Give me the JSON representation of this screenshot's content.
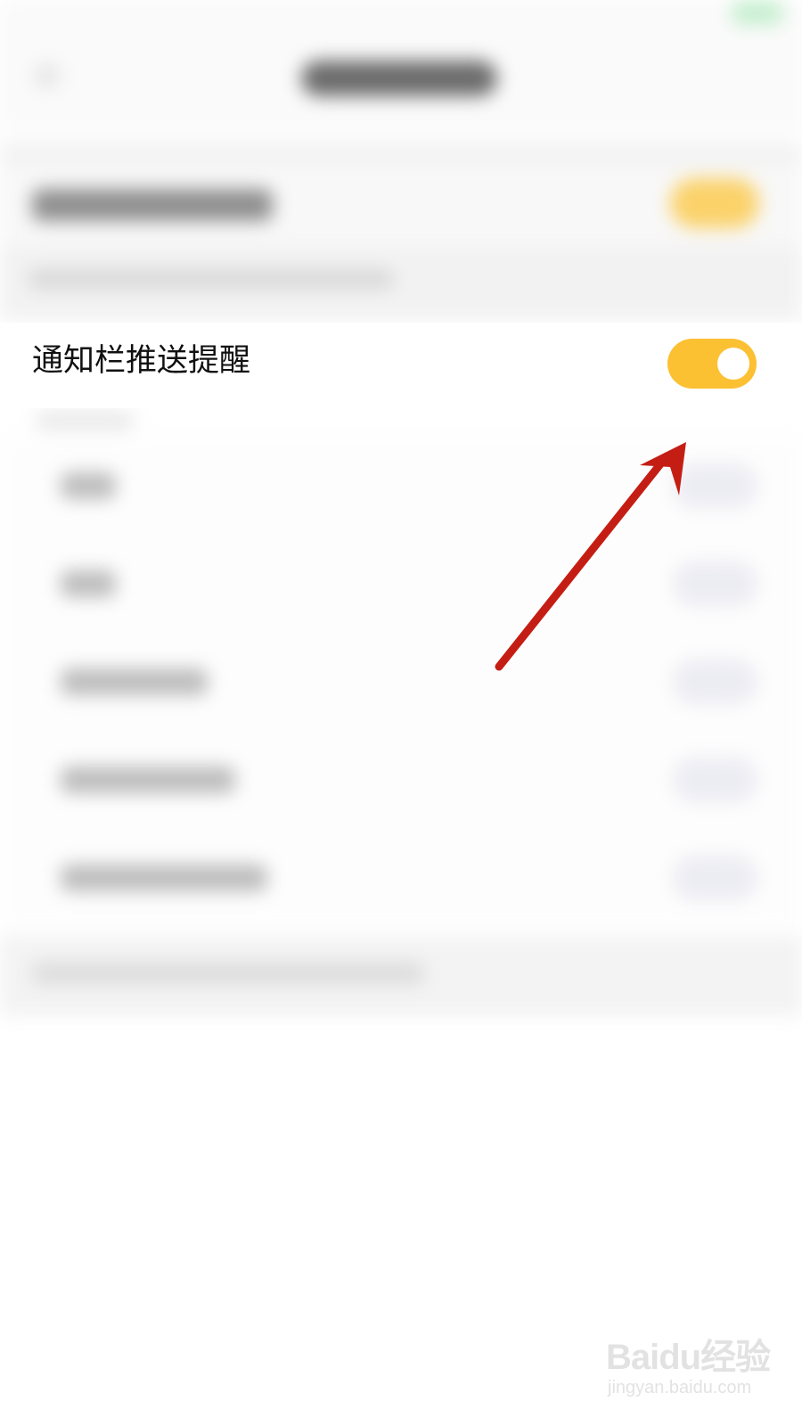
{
  "notification_row": {
    "label": "通知栏推送提醒",
    "toggle_on": true,
    "toggle_color": "#fcc033"
  },
  "annotation": {
    "arrow_color": "#c41e14",
    "arrow_icon": "pointer-arrow-icon"
  },
  "watermark": {
    "logo_text": "Baidu经验",
    "url_text": "jingyan.baidu.com"
  }
}
